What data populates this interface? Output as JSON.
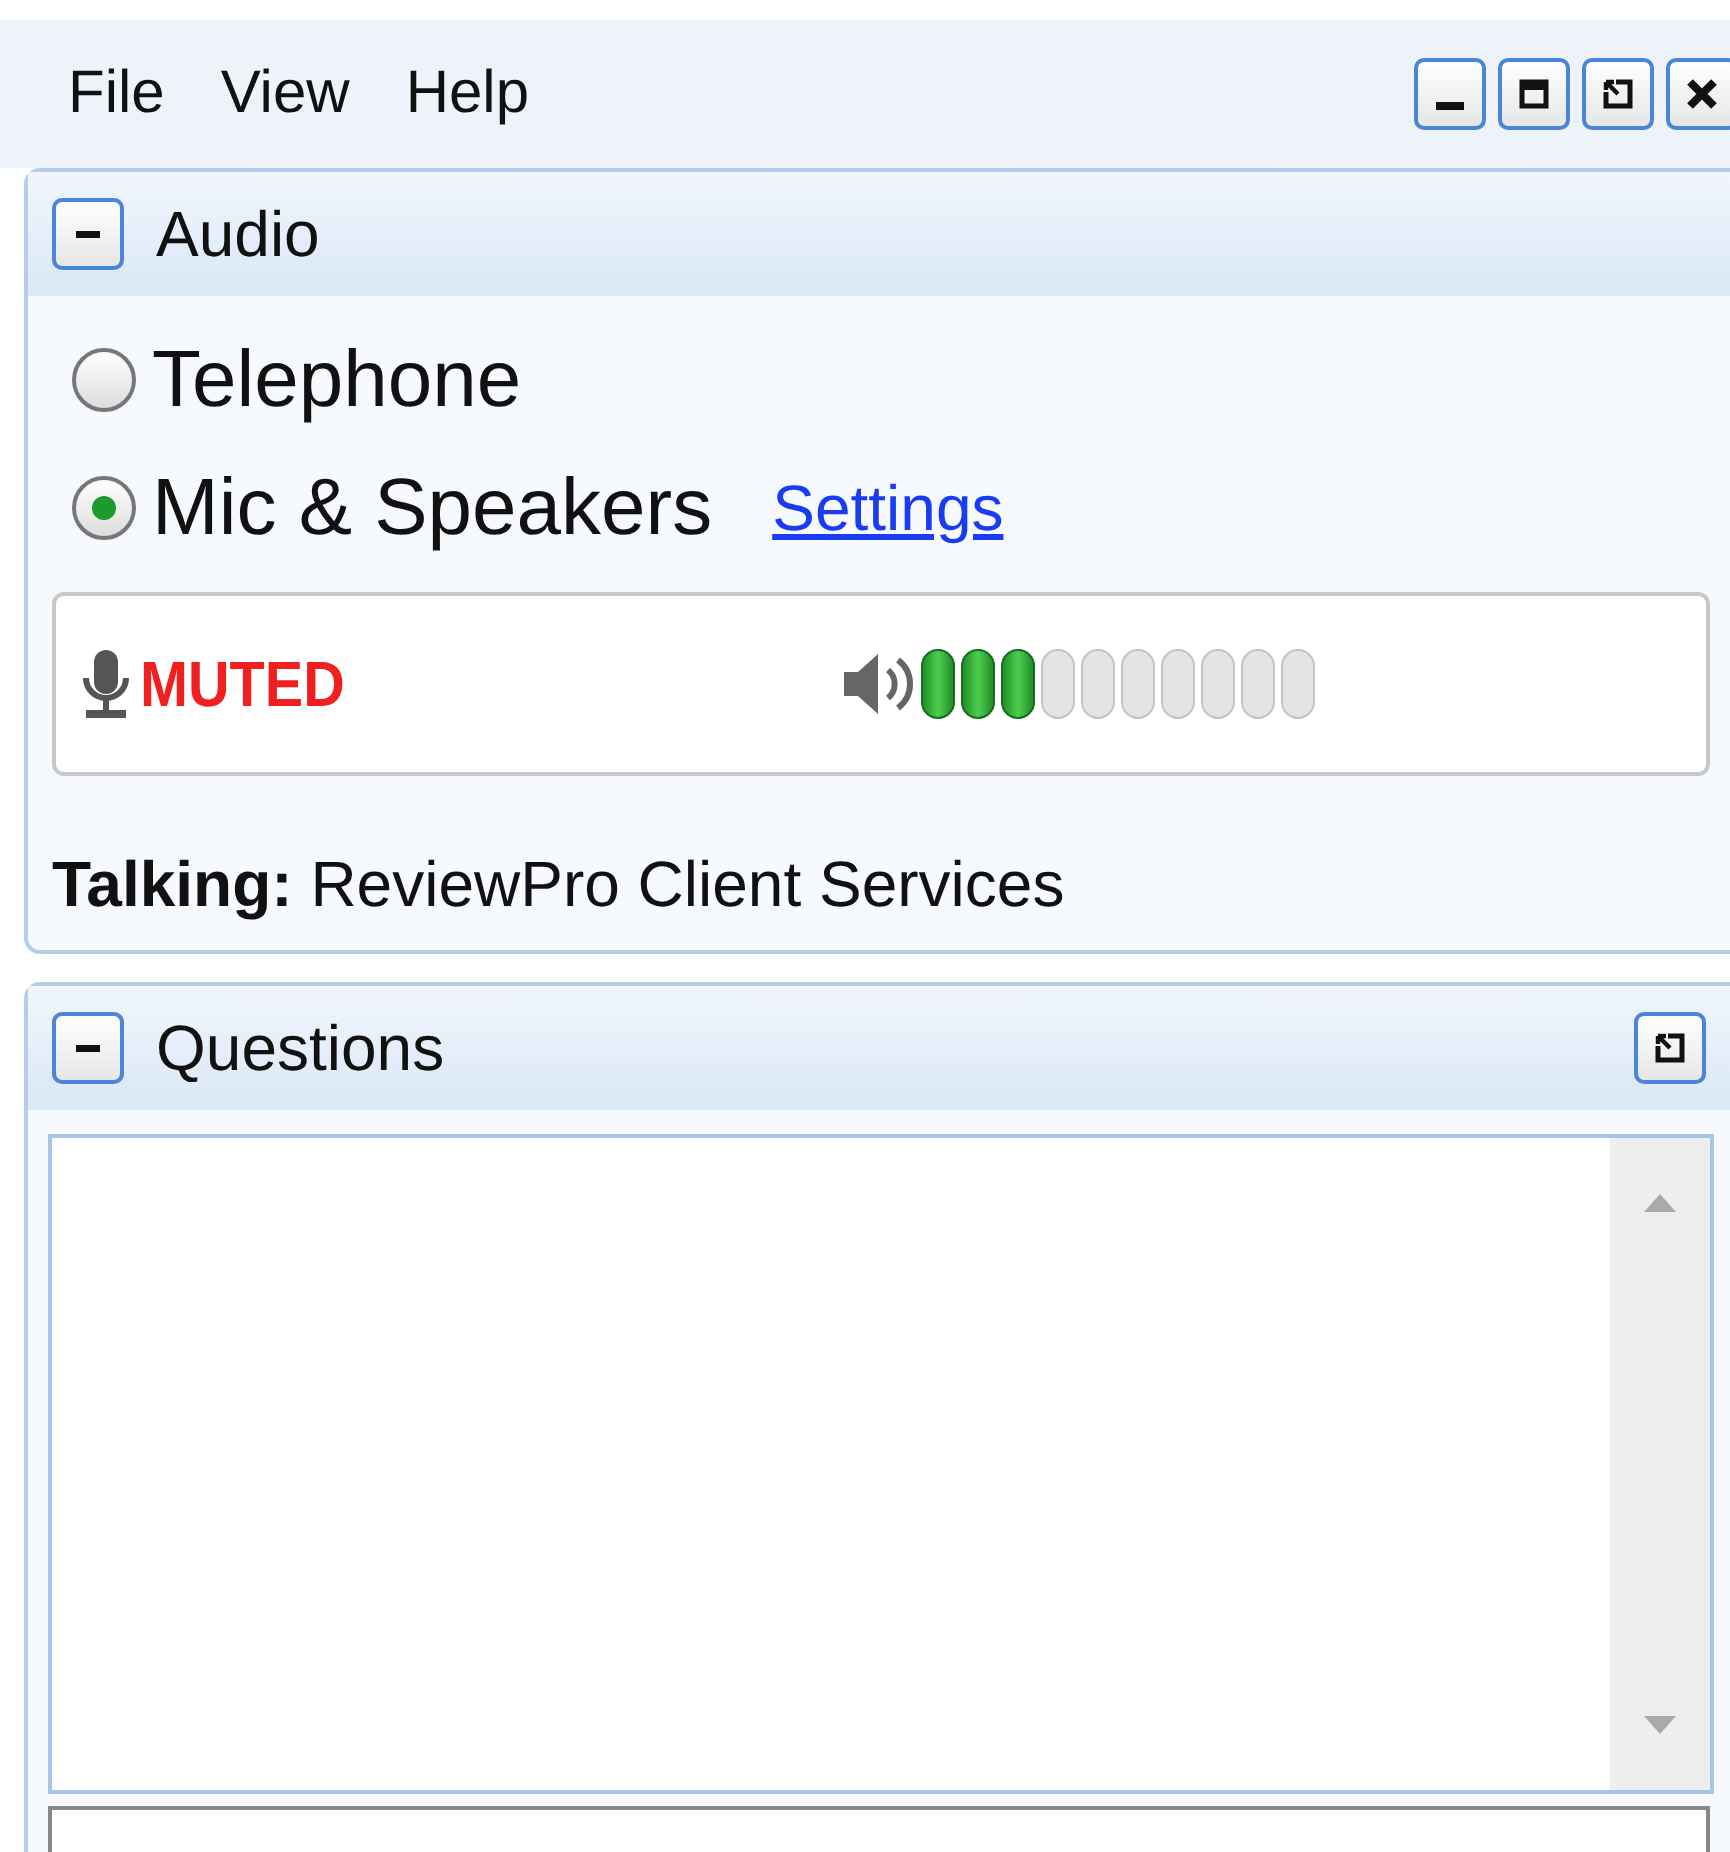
{
  "menu": [
    {
      "label": "File"
    },
    {
      "label": "View"
    },
    {
      "label": "Help"
    }
  ],
  "audio": {
    "title": "Audio",
    "expanded": true,
    "options": [
      {
        "label": "Telephone",
        "selected": false
      },
      {
        "label": "Mic & Speakers",
        "selected": true
      }
    ],
    "settings_link": "Settings",
    "mic_status": "MUTED",
    "speaker": {
      "level": 0.3
    },
    "talking_label": "Talking:",
    "talking_value": "ReviewPro Client Services"
  },
  "questions": {
    "title": "Questions",
    "expanded": true
  }
}
